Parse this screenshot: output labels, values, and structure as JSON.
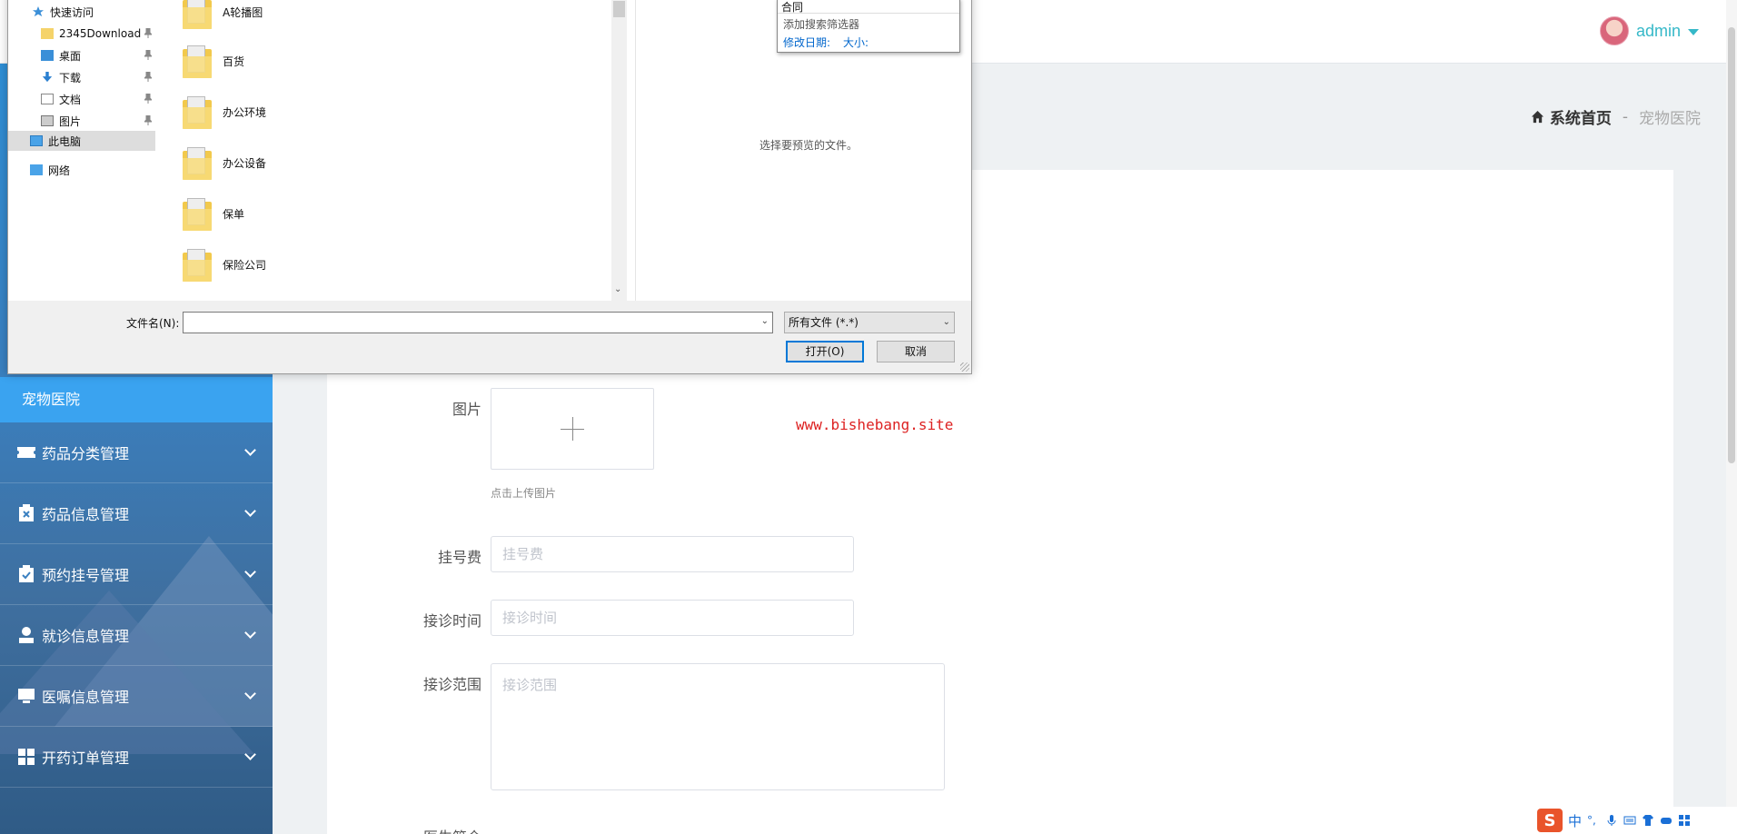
{
  "header": {
    "user_name": "admin"
  },
  "breadcrumb": {
    "home": "系统首页",
    "separator": "-",
    "current": "宠物医院"
  },
  "sidebar": {
    "active_label": "宠物医院",
    "items": [
      {
        "label": "药品分类管理",
        "icon": "ticket-icon"
      },
      {
        "label": "药品信息管理",
        "icon": "medicine-box-icon"
      },
      {
        "label": "预约挂号管理",
        "icon": "clipboard-check-icon"
      },
      {
        "label": "就诊信息管理",
        "icon": "user-icon"
      },
      {
        "label": "医嘱信息管理",
        "icon": "monitor-icon"
      },
      {
        "label": "开药订单管理",
        "icon": "grid-icon"
      }
    ]
  },
  "form": {
    "image_label": "图片",
    "upload_hint": "点击上传图片",
    "fee_label": "挂号费",
    "fee_placeholder": "挂号费",
    "time_label": "接诊时间",
    "time_placeholder": "接诊时间",
    "range_label": "接诊范围",
    "range_placeholder": "接诊范围",
    "intro_label": "医生简介"
  },
  "watermark": "www.bishebang.site",
  "dialog": {
    "nav": [
      {
        "label": "快速访问",
        "icon": "star-icon",
        "pinned": false
      },
      {
        "label": "2345Download",
        "icon": "folder-icon",
        "pinned": true
      },
      {
        "label": "桌面",
        "icon": "desktop-icon",
        "pinned": true
      },
      {
        "label": "下载",
        "icon": "download-icon",
        "pinned": true
      },
      {
        "label": "文档",
        "icon": "document-icon",
        "pinned": true
      },
      {
        "label": "图片",
        "icon": "pictures-icon",
        "pinned": true
      },
      {
        "label": "此电脑",
        "icon": "computer-icon",
        "pinned": false
      },
      {
        "label": "网络",
        "icon": "network-icon",
        "pinned": false
      }
    ],
    "files": [
      "A轮播图",
      "百货",
      "办公环境",
      "办公设备",
      "保单",
      "保险公司"
    ],
    "preview_text": "选择要预览的文件。",
    "search_popup": {
      "top_text": "合同",
      "add_filter": "添加搜索筛选器",
      "modified_date": "修改日期:",
      "size": "大小:"
    },
    "filename_label": "文件名(N):",
    "filename_value": "",
    "filter_value": "所有文件 (*.*)",
    "open_button": "打开(O)",
    "cancel_button": "取消"
  },
  "ime": {
    "logo": "S",
    "mode": "中"
  }
}
